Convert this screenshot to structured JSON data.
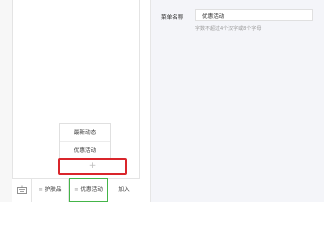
{
  "menu_config": {
    "name_label": "菜单名称",
    "name_value": "优惠活动",
    "name_hint": "字数不超过4个汉字或8个字母"
  },
  "submenu": {
    "items": [
      {
        "label": "最新动态"
      },
      {
        "label": "优惠活动"
      }
    ],
    "add_glyph": "+"
  },
  "menubar": {
    "keyboard_icon": "keyboard-icon",
    "tabs": [
      {
        "dot": "≡",
        "label": "护肤品"
      },
      {
        "dot": "≡",
        "label": "优惠活动"
      },
      {
        "label": "加入"
      }
    ]
  },
  "colors": {
    "highlight_red": "#d9252b",
    "selected_green": "#44b549",
    "panel_bg": "#f4f5f9"
  }
}
